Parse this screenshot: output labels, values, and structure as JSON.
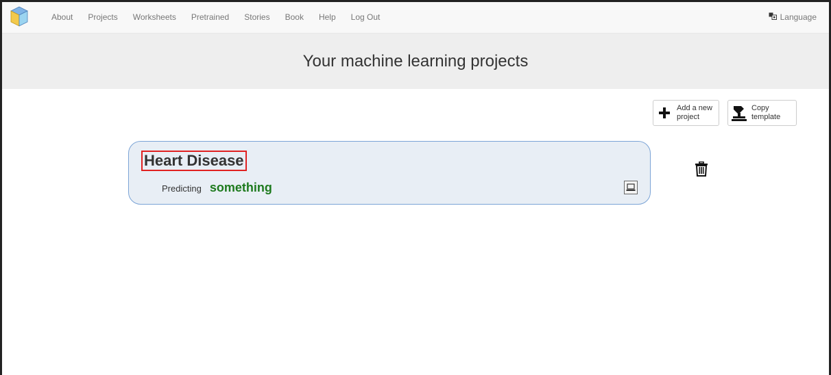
{
  "nav": {
    "items": [
      "About",
      "Projects",
      "Worksheets",
      "Pretrained",
      "Stories",
      "Book",
      "Help",
      "Log Out"
    ],
    "language_label": "Language",
    "logo_icon": "cube-logo-icon",
    "language_icon": "translate-icon"
  },
  "banner": {
    "title": "Your machine learning projects"
  },
  "toolbar": {
    "add_label": "Add a new project",
    "copy_label": "Copy template",
    "add_icon": "plus-icon",
    "copy_icon": "copy-template-icon"
  },
  "projects": [
    {
      "name": "Heart Disease",
      "predicting_label": "Predicting",
      "type": "something",
      "type_color": "#1e7a1e",
      "device_icon": "laptop-icon",
      "delete_icon": "trash-icon"
    }
  ],
  "colors": {
    "card_background": "#e8eef5",
    "card_border": "#7aa3d6",
    "highlight": "#e02020"
  }
}
